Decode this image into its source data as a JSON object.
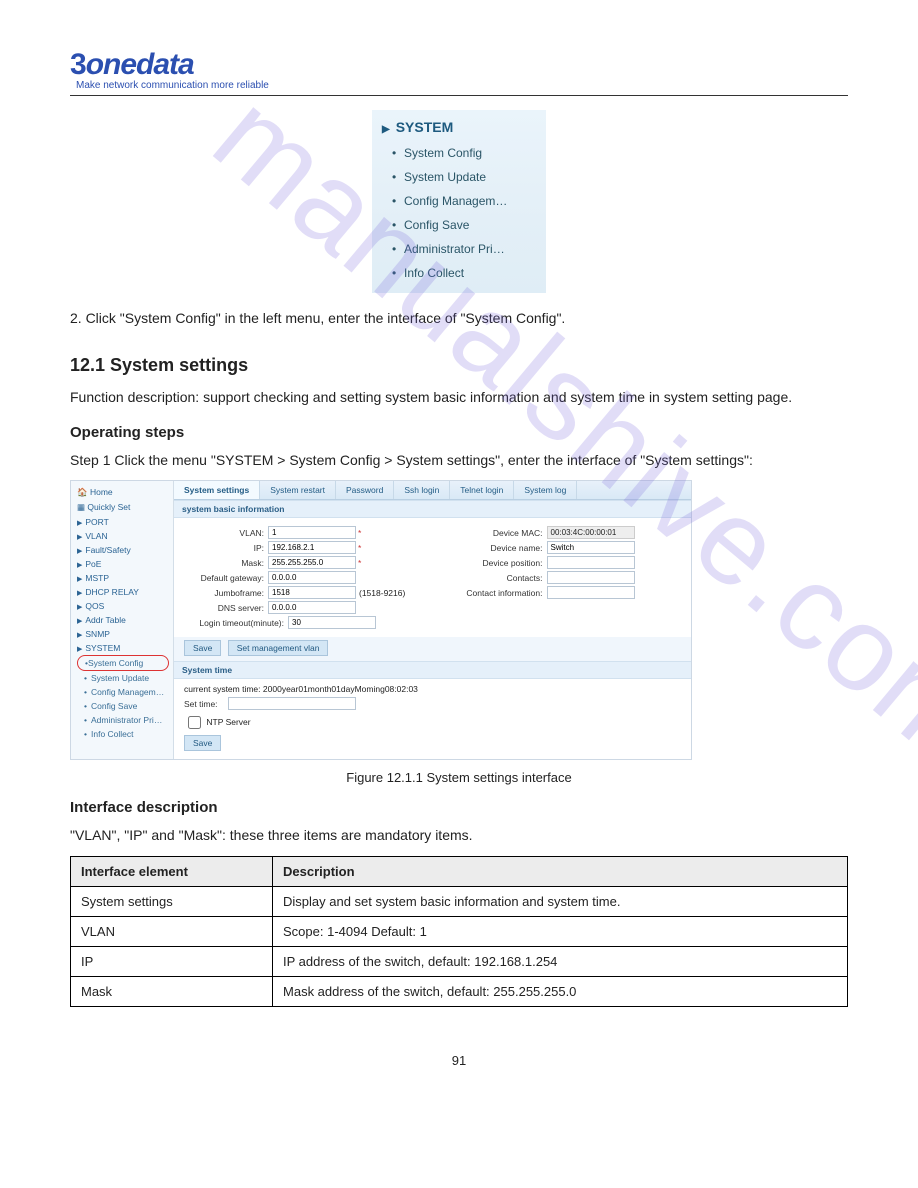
{
  "brand": {
    "name": "3onedata",
    "tagline": "Make network communication more reliable"
  },
  "menu": {
    "header": "SYSTEM",
    "items": [
      "System Config",
      "System Update",
      "Config Managem…",
      "Config Save",
      "Administrator Pri…",
      "Info Collect"
    ]
  },
  "para1": "2. Click \"System Config\" in the left menu, enter the interface of \"System Config\".",
  "sec_heading": "12.1 System settings",
  "para2": "Function description: support checking and setting system basic information and system time in system setting page.",
  "step_heading": "Operating steps",
  "step1": "Step 1   Click the menu \"SYSTEM > System Config > System settings\", enter the interface of \"System settings\":",
  "screenshot": {
    "sidebar": {
      "home": "Home",
      "quick": "Quickly Set",
      "cats": [
        "PORT",
        "VLAN",
        "Fault/Safety",
        "PoE",
        "MSTP",
        "DHCP RELAY",
        "QOS",
        "Addr Table",
        "SNMP",
        "SYSTEM"
      ],
      "system_items": [
        "System Config",
        "System Update",
        "Config Managem…",
        "Config Save",
        "Administrator Pri…",
        "Info Collect"
      ]
    },
    "tabs": [
      "System settings",
      "System restart",
      "Password",
      "Ssh login",
      "Telnet login",
      "System log"
    ],
    "panel1_title": "system basic information",
    "left_fields": {
      "vlan_l": "VLAN:",
      "vlan_v": "1",
      "ip_l": "IP:",
      "ip_v": "192.168.2.1",
      "mask_l": "Mask:",
      "mask_v": "255.255.255.0",
      "gw_l": "Default gateway:",
      "gw_v": "0.0.0.0",
      "jf_l": "Jumboframe:",
      "jf_v": "1518",
      "jf_hint": "(1518-9216)",
      "dns_l": "DNS server:",
      "dns_v": "0.0.0.0",
      "to_l": "Login timeout(minute):",
      "to_v": "30"
    },
    "right_fields": {
      "mac_l": "Device MAC:",
      "mac_v": "00:03:4C:00:00:01",
      "name_l": "Device name:",
      "name_v": "Switch",
      "pos_l": "Device position:",
      "pos_v": "",
      "con_l": "Contacts:",
      "con_v": "",
      "ci_l": "Contact information:",
      "ci_v": ""
    },
    "btn_save": "Save",
    "btn_setvlan": "Set management vlan",
    "panel2_title": "System time",
    "cur_time_label": "current system time:",
    "cur_time_value": "2000year01month01dayMoming08:02:03",
    "settime_l": "Set time:",
    "ntp_l": "NTP Server",
    "btn_save2": "Save"
  },
  "figcap": "Figure 12.1.1  System settings interface",
  "interface_heading": "Interface description",
  "para3": "\"VLAN\", \"IP\" and \"Mask\": these three items are mandatory items.",
  "table": {
    "h1": "Interface element",
    "h2": "Description",
    "r1c1": "System settings",
    "r1c2": "Display and set system basic information and system time.",
    "r2c1": "VLAN",
    "r2c2": "Scope: 1-4094 Default: 1",
    "r3c1": "IP",
    "r3c2": "IP address of the switch, default: 192.168.1.254",
    "r4c1": "Mask",
    "r4c2": "Mask address of the switch, default: 255.255.255.0"
  },
  "page": "91"
}
